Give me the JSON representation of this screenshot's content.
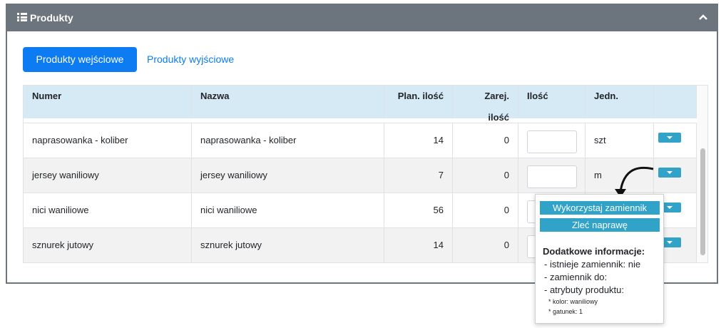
{
  "panel": {
    "title": "Produkty"
  },
  "tabs": {
    "active": "Produkty wejściowe",
    "inactive": "Produkty wyjściowe"
  },
  "table": {
    "headers": [
      "Numer",
      "Nazwa",
      "Plan. ilość",
      "Zarej. ilość",
      "Ilość",
      "Jedn.",
      ""
    ],
    "rows": [
      {
        "numer": "naprasowanka - koliber",
        "nazwa": "naprasowanka - koliber",
        "plan": "14",
        "zarej": "0",
        "jedn": "szt"
      },
      {
        "numer": "jersey waniliowy",
        "nazwa": "jersey waniliowy",
        "plan": "7",
        "zarej": "0",
        "jedn": "m"
      },
      {
        "numer": "nici waniliowe",
        "nazwa": "nici waniliowe",
        "plan": "56",
        "zarej": "0",
        "jedn": ""
      },
      {
        "numer": "sznurek jutowy",
        "nazwa": "sznurek jutowy",
        "plan": "14",
        "zarej": "0",
        "jedn": ""
      }
    ]
  },
  "popup": {
    "btn1": "Wykorzystaj zamiennik",
    "btn2": "Zleć naprawę",
    "info_title": "Dodatkowe informacje:",
    "line1": "- istnieje zamiennik: nie",
    "line2": "- zamiennik do:",
    "line3": "- atrybuty produktu:",
    "attr1": "* kolor: waniliowy",
    "attr2": "* gatunek: 1"
  },
  "colors": {
    "header": "#6c757d",
    "primary": "#0d7cf2",
    "info": "#31a3c8",
    "thead": "#d6eaf5"
  }
}
